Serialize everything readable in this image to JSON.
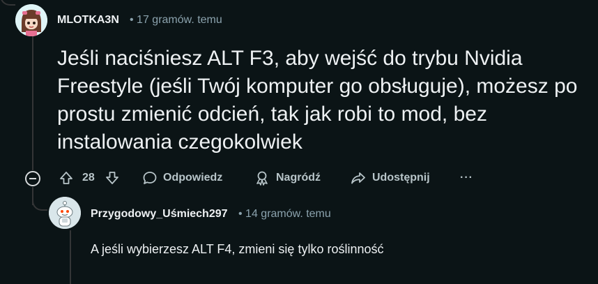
{
  "comment": {
    "username": "MLOTKA3N",
    "time": "17 gramów. temu",
    "body": "Jeśli naciśniesz ALT F3, aby wejść do trybu Nvidia Freestyle (jeśli Twój komputer go obsługuje), możesz po prostu zmienić odcień, tak jak robi to mod, bez instalowania czegokolwiek",
    "score": "28",
    "actions": {
      "reply": "Odpowiedz",
      "award": "Nagródź",
      "share": "Udostępnij",
      "more": "···"
    }
  },
  "reply": {
    "username": "Przygodowy_Uśmiech297",
    "time": "14 gramów. temu",
    "body": "A jeśli wybierzesz ALT F4, zmieni się tylko roślinność"
  },
  "colors": {
    "background": "#0b1416",
    "text": "#eef1f3",
    "muted": "#8ba2ad",
    "thread_line": "#343536"
  }
}
